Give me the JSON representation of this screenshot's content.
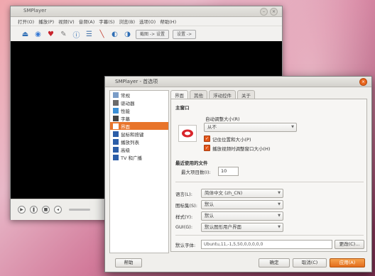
{
  "player": {
    "title": "SMPlayer",
    "menu": [
      "打开(O)",
      "播放(P)",
      "视频(V)",
      "音频(A)",
      "字幕(S)",
      "浏览(B)",
      "选项(O)",
      "帮助(H)"
    ],
    "toolbar_buttons": [
      "截图 -> 设置",
      "设置 ->"
    ]
  },
  "dialog": {
    "title": "SMPlayer - 首选项",
    "sidebar": [
      "常规",
      "驱动器",
      "性能",
      "字幕",
      "界面",
      "鼠标和按键",
      "播放列表",
      "高级",
      "TV 和广播"
    ],
    "active_index": 4,
    "tabs": [
      "界面",
      "其他",
      "浮动控件",
      "关于"
    ],
    "active_tab": 0,
    "section_main": "主窗口",
    "resize_label": "自动调整大小(R)",
    "resize_value": "从不",
    "check1": "记住位置和大小(P)",
    "check2": "播放视频时调整窗口大小(H)",
    "section_recent": "最近使用的文件",
    "max_items_label": "最大项目数(I):",
    "max_items_value": "10",
    "rows": [
      {
        "label": "语言(L):",
        "value": "简体中文 (zh_CN)"
      },
      {
        "label": "图标集(S):",
        "value": "默认"
      },
      {
        "label": "样式(Y):",
        "value": "默认"
      },
      {
        "label": "GUI(G):",
        "value": "默认图形用户界面"
      }
    ],
    "font_label": "默认字体:",
    "font_value": "Ubuntu,11,-1,5,50,0,0,0,0,0",
    "font_btn": "更改(C)...",
    "help_btn": "帮助",
    "ok_btn": "确定",
    "cancel_btn": "取消(C)",
    "apply_btn": "应用(A)"
  },
  "colors": {
    "accent": "#e8742a"
  }
}
